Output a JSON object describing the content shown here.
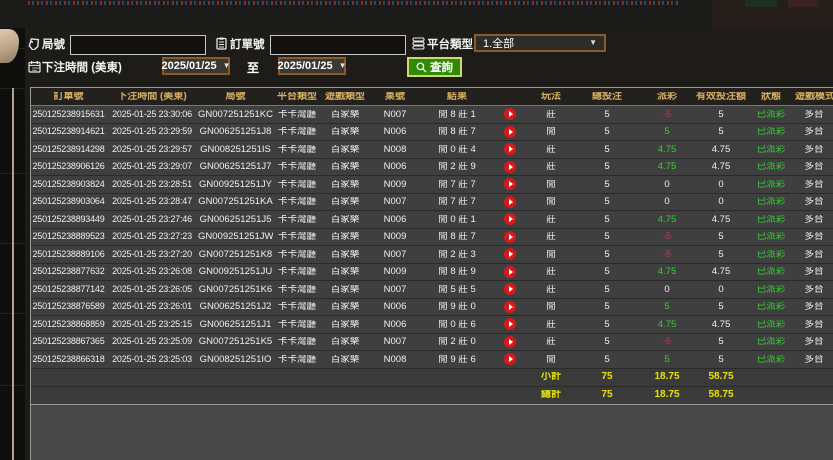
{
  "filters": {
    "game_no_label": "局號",
    "game_no_value": "",
    "order_no_label": "訂單號",
    "order_no_value": "",
    "platform_label": "平台類型",
    "platform_value": "1.全部",
    "bet_time_label": "下注時間 (美東)",
    "date_from": "2025/01/25",
    "to_label": "至",
    "date_to": "2025/01/25",
    "query_label": "查詢"
  },
  "table": {
    "headers": [
      "訂單號",
      "下注時間 (美東)",
      "局號",
      "平台類型",
      "遊戲類型",
      "桌號",
      "結果",
      "",
      "玩法",
      "總投注",
      "派彩",
      "有效投注額",
      "狀態",
      "遊戲模式"
    ],
    "rows": [
      {
        "order": "250125238915631",
        "time": "2025-01-25 23:30:06",
        "game_no": "GN007251251KC",
        "platform": "卡卡灣廳",
        "game_type": "百家樂",
        "table_no": "N007",
        "result": "閒 8 莊 1",
        "play": "莊",
        "total_bet": "5",
        "payout": "-5",
        "payout_color": "neg",
        "valid_bet": "5",
        "status": "已派彩",
        "mode": "多台"
      },
      {
        "order": "250125238914621",
        "time": "2025-01-25 23:29:59",
        "game_no": "GN006251251J8",
        "platform": "卡卡灣廳",
        "game_type": "百家樂",
        "table_no": "N006",
        "result": "閒 8 莊 7",
        "play": "閒",
        "total_bet": "5",
        "payout": "5",
        "payout_color": "pos",
        "valid_bet": "5",
        "status": "已派彩",
        "mode": "多台"
      },
      {
        "order": "250125238914298",
        "time": "2025-01-25 23:29:57",
        "game_no": "GN008251251IS",
        "platform": "卡卡灣廳",
        "game_type": "百家樂",
        "table_no": "N008",
        "result": "閒 0 莊 4",
        "play": "莊",
        "total_bet": "5",
        "payout": "4.75",
        "payout_color": "pos",
        "valid_bet": "4.75",
        "status": "已派彩",
        "mode": "多台"
      },
      {
        "order": "250125238906126",
        "time": "2025-01-25 23:29:07",
        "game_no": "GN006251251J7",
        "platform": "卡卡灣廳",
        "game_type": "百家樂",
        "table_no": "N006",
        "result": "閒 2 莊 9",
        "play": "莊",
        "total_bet": "5",
        "payout": "4.75",
        "payout_color": "pos",
        "valid_bet": "4.75",
        "status": "已派彩",
        "mode": "多台"
      },
      {
        "order": "250125238903824",
        "time": "2025-01-25 23:28:51",
        "game_no": "GN009251251JY",
        "platform": "卡卡灣廳",
        "game_type": "百家樂",
        "table_no": "N009",
        "result": "閒 7 莊 7",
        "play": "閒",
        "total_bet": "5",
        "payout": "0",
        "payout_color": "zero",
        "valid_bet": "0",
        "status": "已派彩",
        "mode": "多台"
      },
      {
        "order": "250125238903064",
        "time": "2025-01-25 23:28:47",
        "game_no": "GN007251251KA",
        "platform": "卡卡灣廳",
        "game_type": "百家樂",
        "table_no": "N007",
        "result": "閒 7 莊 7",
        "play": "閒",
        "total_bet": "5",
        "payout": "0",
        "payout_color": "zero",
        "valid_bet": "0",
        "status": "已派彩",
        "mode": "多台"
      },
      {
        "order": "250125238893449",
        "time": "2025-01-25 23:27:46",
        "game_no": "GN006251251J5",
        "platform": "卡卡灣廳",
        "game_type": "百家樂",
        "table_no": "N006",
        "result": "閒 0 莊 1",
        "play": "莊",
        "total_bet": "5",
        "payout": "4.75",
        "payout_color": "pos",
        "valid_bet": "4.75",
        "status": "已派彩",
        "mode": "多台"
      },
      {
        "order": "250125238889523",
        "time": "2025-01-25 23:27:23",
        "game_no": "GN009251251JW",
        "platform": "卡卡灣廳",
        "game_type": "百家樂",
        "table_no": "N009",
        "result": "閒 8 莊 7",
        "play": "莊",
        "total_bet": "5",
        "payout": "-5",
        "payout_color": "neg",
        "valid_bet": "5",
        "status": "已派彩",
        "mode": "多台"
      },
      {
        "order": "250125238889106",
        "time": "2025-01-25 23:27:20",
        "game_no": "GN007251251K8",
        "platform": "卡卡灣廳",
        "game_type": "百家樂",
        "table_no": "N007",
        "result": "閒 2 莊 3",
        "play": "閒",
        "total_bet": "5",
        "payout": "-5",
        "payout_color": "neg",
        "valid_bet": "5",
        "status": "已派彩",
        "mode": "多台"
      },
      {
        "order": "250125238877632",
        "time": "2025-01-25 23:26:08",
        "game_no": "GN009251251JU",
        "platform": "卡卡灣廳",
        "game_type": "百家樂",
        "table_no": "N009",
        "result": "閒 8 莊 9",
        "play": "莊",
        "total_bet": "5",
        "payout": "4.75",
        "payout_color": "pos",
        "valid_bet": "4.75",
        "status": "已派彩",
        "mode": "多台"
      },
      {
        "order": "250125238877142",
        "time": "2025-01-25 23:26:05",
        "game_no": "GN007251251K6",
        "platform": "卡卡灣廳",
        "game_type": "百家樂",
        "table_no": "N007",
        "result": "閒 5 莊 5",
        "play": "莊",
        "total_bet": "5",
        "payout": "0",
        "payout_color": "zero",
        "valid_bet": "0",
        "status": "已派彩",
        "mode": "多台"
      },
      {
        "order": "250125238876589",
        "time": "2025-01-25 23:26:01",
        "game_no": "GN006251251J2",
        "platform": "卡卡灣廳",
        "game_type": "百家樂",
        "table_no": "N006",
        "result": "閒 9 莊 0",
        "play": "閒",
        "total_bet": "5",
        "payout": "5",
        "payout_color": "pos",
        "valid_bet": "5",
        "status": "已派彩",
        "mode": "多台"
      },
      {
        "order": "250125238868859",
        "time": "2025-01-25 23:25:15",
        "game_no": "GN006251251J1",
        "platform": "卡卡灣廳",
        "game_type": "百家樂",
        "table_no": "N006",
        "result": "閒 0 莊 6",
        "play": "莊",
        "total_bet": "5",
        "payout": "4.75",
        "payout_color": "pos",
        "valid_bet": "4.75",
        "status": "已派彩",
        "mode": "多台"
      },
      {
        "order": "250125238867365",
        "time": "2025-01-25 23:25:09",
        "game_no": "GN007251251K5",
        "platform": "卡卡灣廳",
        "game_type": "百家樂",
        "table_no": "N007",
        "result": "閒 2 莊 0",
        "play": "莊",
        "total_bet": "5",
        "payout": "-5",
        "payout_color": "neg",
        "valid_bet": "5",
        "status": "已派彩",
        "mode": "多台"
      },
      {
        "order": "250125238866318",
        "time": "2025-01-25 23:25:03",
        "game_no": "GN008251251IO",
        "platform": "卡卡灣廳",
        "game_type": "百家樂",
        "table_no": "N008",
        "result": "閒 9 莊 6",
        "play": "閒",
        "total_bet": "5",
        "payout": "5",
        "payout_color": "pos",
        "valid_bet": "5",
        "status": "已派彩",
        "mode": "多台"
      }
    ],
    "subtotal": {
      "label": "小計",
      "total_bet": "75",
      "payout": "18.75",
      "valid_bet": "58.75"
    },
    "total": {
      "label": "總計",
      "total_bet": "75",
      "payout": "18.75",
      "valid_bet": "58.75"
    }
  },
  "colors": {
    "accent_gold": "#d6ae62",
    "positive_green": "#35cf35",
    "negative_red": "#c23a4a",
    "totals_yellow": "#e8e400",
    "query_green": "#2f8a06",
    "date_border_orange": "#8a5a28"
  }
}
